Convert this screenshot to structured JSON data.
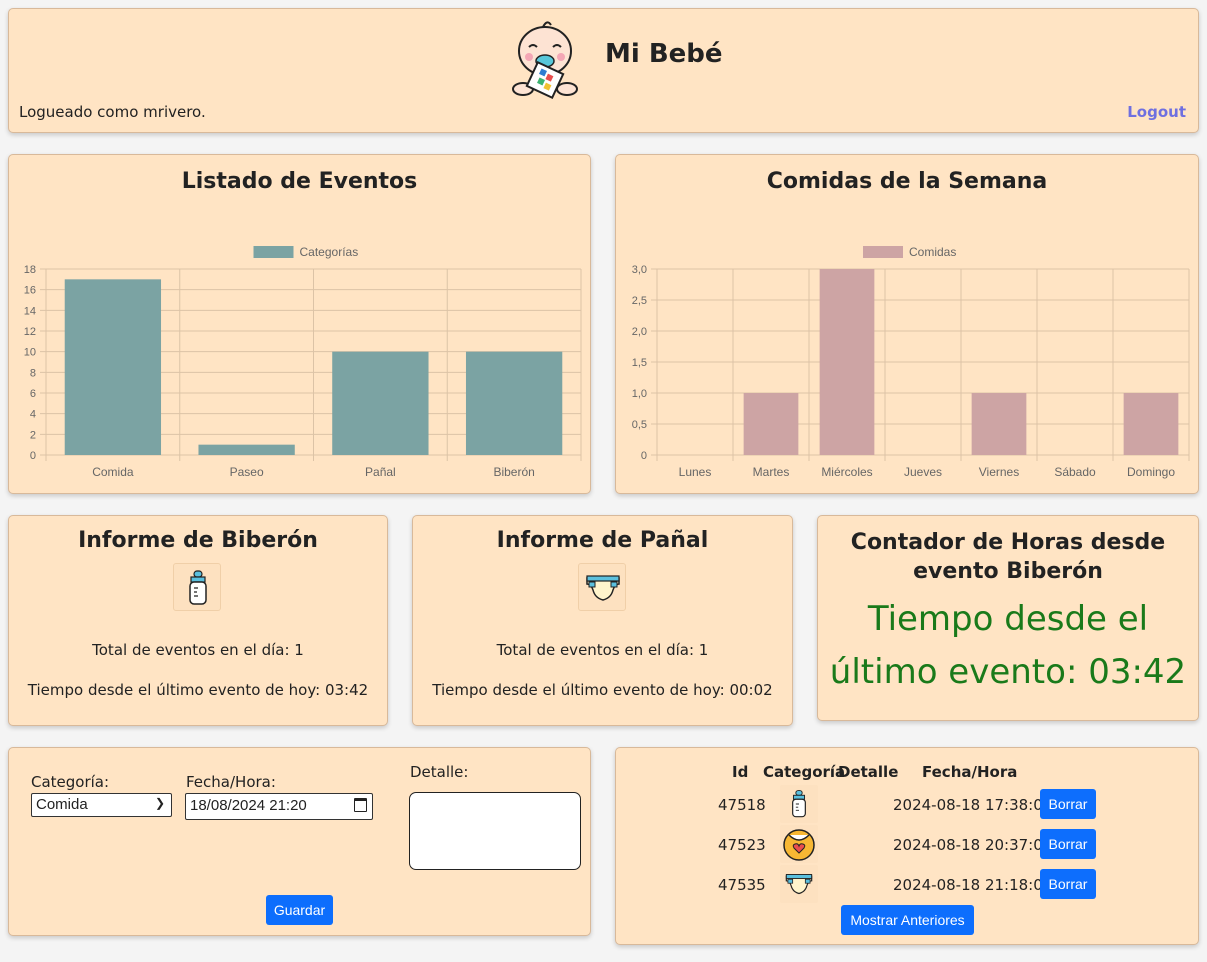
{
  "header": {
    "title": "Mi Bebé",
    "logged_as": "Logueado como mrivero.",
    "logout": "Logout"
  },
  "events_chart": {
    "title": "Listado de Eventos",
    "chart_data": {
      "type": "bar",
      "categories": [
        "Comida",
        "Paseo",
        "Pañal",
        "Biberón"
      ],
      "series": [
        {
          "name": "Categorías",
          "values": [
            17,
            1,
            10,
            10
          ]
        }
      ],
      "yticks": [
        "0",
        "2",
        "4",
        "6",
        "8",
        "10",
        "12",
        "14",
        "16",
        "18"
      ],
      "ylim": [
        0,
        18
      ],
      "legend": "top",
      "color": "#7ba3a3",
      "grid": true
    }
  },
  "meals_chart": {
    "title": "Comidas de la Semana",
    "chart_data": {
      "type": "bar",
      "categories": [
        "Lunes",
        "Martes",
        "Miércoles",
        "Jueves",
        "Viernes",
        "Sábado",
        "Domingo"
      ],
      "series": [
        {
          "name": "Comidas",
          "values": [
            0,
            1,
            3,
            0,
            1,
            0,
            1
          ]
        }
      ],
      "yticks": [
        "0",
        "0,5",
        "1,0",
        "1,5",
        "2,0",
        "2,5",
        "3,0"
      ],
      "ylim": [
        0,
        3
      ],
      "legend": "top",
      "color": "#cda4a4",
      "grid": true
    }
  },
  "bottle_report": {
    "title": "Informe de Biberón",
    "icon": "baby-bottle-icon",
    "total": "Total de eventos en el día: 1",
    "since": "Tiempo desde el último evento de hoy: 03:42"
  },
  "diaper_report": {
    "title": "Informe de Pañal",
    "icon": "diaper-icon",
    "total": "Total de eventos en el día: 1",
    "since": "Tiempo desde el último evento de hoy: 00:02"
  },
  "counter": {
    "title": "Contador de Horas desde evento Biberón",
    "text_line1": "Tiempo desde el",
    "text_line2": "último evento: 03:42",
    "color": "#1a7a1a"
  },
  "form": {
    "category_label": "Categoría:",
    "category_value": "Comida",
    "datetime_label": "Fecha/Hora:",
    "datetime_value": "18/08/2024 21:20",
    "detail_label": "Detalle:",
    "save_label": "Guardar"
  },
  "table": {
    "headers": [
      "Id",
      "Categoría",
      "Detalle",
      "Fecha/Hora"
    ],
    "rows": [
      {
        "id": "47518",
        "icon": "baby-bottle-icon",
        "datetime": "2024-08-18 17:38:00",
        "action": "Borrar"
      },
      {
        "id": "47523",
        "icon": "bib-icon",
        "datetime": "2024-08-18 20:37:00",
        "action": "Borrar"
      },
      {
        "id": "47535",
        "icon": "diaper-icon",
        "datetime": "2024-08-18 21:18:00",
        "action": "Borrar"
      }
    ],
    "show_more": "Mostrar Anteriores"
  },
  "colors": {
    "card_bg": "#ffe4c4",
    "button": "#0d6efd",
    "logout": "#6f6fe0"
  }
}
